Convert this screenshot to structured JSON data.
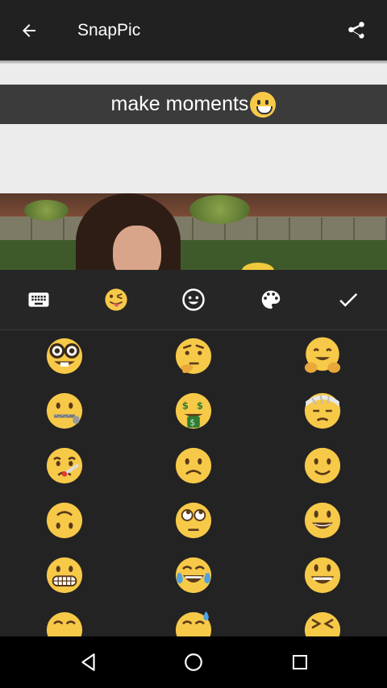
{
  "app": {
    "title": "SnapPic"
  },
  "caption": {
    "text": "make moments"
  },
  "toolbar": {
    "items": [
      {
        "icon": "keyboard-icon"
      },
      {
        "icon": "emoji-category-icon"
      },
      {
        "icon": "smiley-icon"
      },
      {
        "icon": "palette-icon"
      },
      {
        "icon": "check-icon"
      }
    ]
  },
  "emoji_grid": {
    "rows": [
      [
        "nerd-face",
        "thinking-face",
        "hugging-face"
      ],
      [
        "zipper-mouth-face",
        "money-mouth-face",
        "head-bandage-face"
      ],
      [
        "thermometer-face",
        "slightly-frowning-face",
        "slightly-smiling-face"
      ],
      [
        "upside-down-face",
        "rolling-eyes-face",
        "smiley-face"
      ],
      [
        "grimacing-face",
        "joy-face",
        "smile-face"
      ],
      [
        "grinning-face-partial",
        "sweat-smile-face-partial",
        "laughing-face-partial"
      ]
    ]
  },
  "navbar": {
    "items": [
      "back-icon",
      "home-icon",
      "recents-icon"
    ]
  },
  "colors": {
    "emoji": "#f7c948",
    "appbar": "#212121",
    "panel": "#232323"
  }
}
